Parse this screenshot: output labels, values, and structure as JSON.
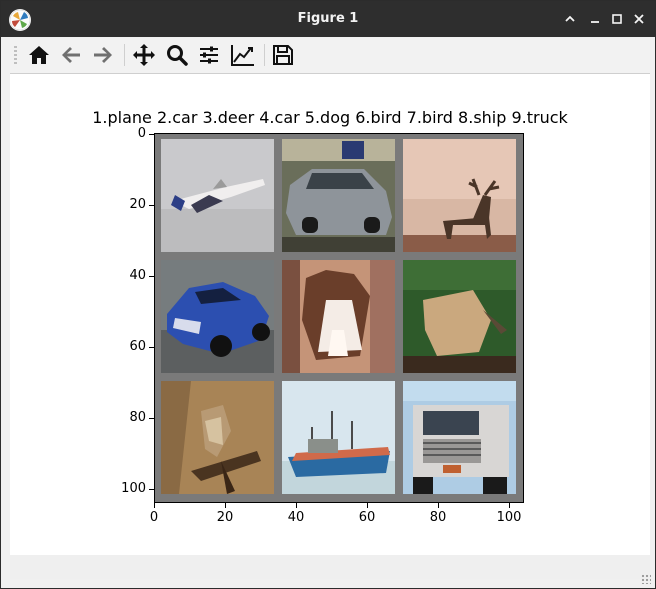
{
  "window": {
    "title": "Figure 1",
    "controls": {
      "minimize": "−",
      "maximize": "□",
      "collapse": "⌃",
      "close": "✕"
    }
  },
  "toolbar": {
    "buttons": [
      {
        "name": "home-icon",
        "tooltip": "Home"
      },
      {
        "name": "back-icon",
        "tooltip": "Back"
      },
      {
        "name": "forward-icon",
        "tooltip": "Forward"
      },
      {
        "name": "pan-icon",
        "tooltip": "Pan"
      },
      {
        "name": "zoom-icon",
        "tooltip": "Zoom"
      },
      {
        "name": "subplots-icon",
        "tooltip": "Subplots"
      },
      {
        "name": "customize-icon",
        "tooltip": "Customize"
      },
      {
        "name": "save-icon",
        "tooltip": "Save"
      }
    ]
  },
  "figure": {
    "title": "1.plane 2.car 3.deer 4.car 5.dog 6.bird 7.bird 8.ship 9.truck",
    "yticks": [
      "0",
      "20",
      "40",
      "60",
      "80",
      "100"
    ],
    "xticks": [
      "0",
      "20",
      "40",
      "60",
      "80",
      "100"
    ],
    "images": [
      "plane",
      "car",
      "deer",
      "car",
      "dog",
      "bird",
      "bird",
      "ship",
      "truck"
    ]
  },
  "colors": {
    "titlebar": "#2e2e2e",
    "grid_background": "#7a7a7a"
  }
}
